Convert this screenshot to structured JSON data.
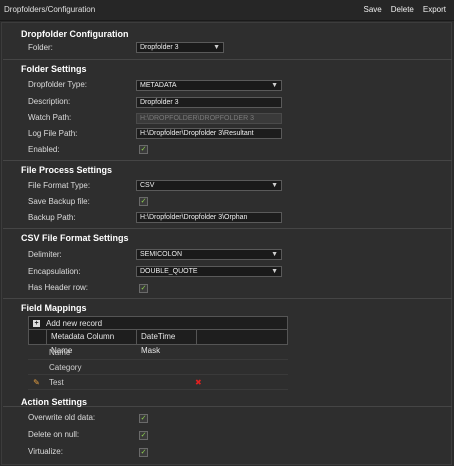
{
  "header": {
    "title": "Dropfolders/Configuration",
    "save": "Save",
    "delete": "Delete",
    "export": "Export"
  },
  "dropfolder_config": {
    "title": "Dropfolder Configuration",
    "folder_label": "Folder:",
    "folder_value": "Dropfolder 3"
  },
  "folder_settings": {
    "title": "Folder Settings",
    "type_label": "Dropfolder Type:",
    "type_value": "METADATA",
    "description_label": "Description:",
    "description_value": "Dropfolder 3",
    "watch_label": "Watch Path:",
    "watch_value": "H:\\DROPFOLDER\\DROPFOLDER 3",
    "log_label": "Log File Path:",
    "log_value": "H:\\Dropfolder\\Dropfolder 3\\Resultant",
    "enabled_label": "Enabled:",
    "enabled": true
  },
  "file_process": {
    "title": "File Process Settings",
    "format_label": "File Format Type:",
    "format_value": "CSV",
    "save_backup_label": "Save Backup file:",
    "save_backup": true,
    "backup_path_label": "Backup Path:",
    "backup_path_value": "H:\\Dropfolder\\Dropfolder 3\\Orphan"
  },
  "csv_settings": {
    "title": "CSV File Format Settings",
    "delimiter_label": "Delimiter:",
    "delimiter_value": "SEMICOLON",
    "encapsulation_label": "Encapsulation:",
    "encapsulation_value": "DOUBLE_QUOTE",
    "header_label": "Has Header row:",
    "has_header": true
  },
  "field_mappings": {
    "title": "Field Mappings",
    "add_record": "Add new record",
    "columns": [
      "Metadata Column Name",
      "DateTime Mask"
    ],
    "rows": [
      "Name",
      "Category",
      "Test"
    ]
  },
  "action_settings": {
    "title": "Action Settings",
    "overwrite_label": "Overwrite old data:",
    "overwrite": true,
    "delete_null_label": "Delete on null:",
    "delete_null": true,
    "virtualize_label": "Virtualize:",
    "virtualize": true
  },
  "icons": {
    "check": "checkmark-icon",
    "chevron": "chevron-down-icon",
    "add": "plus-icon",
    "edit": "pencil-icon",
    "remove": "delete-x-icon"
  },
  "colors": {
    "background": "#2b2b2b",
    "panel": "#2e2e2e",
    "check": "#8fd14f",
    "delete": "#e02020",
    "edit": "#e8a040"
  }
}
